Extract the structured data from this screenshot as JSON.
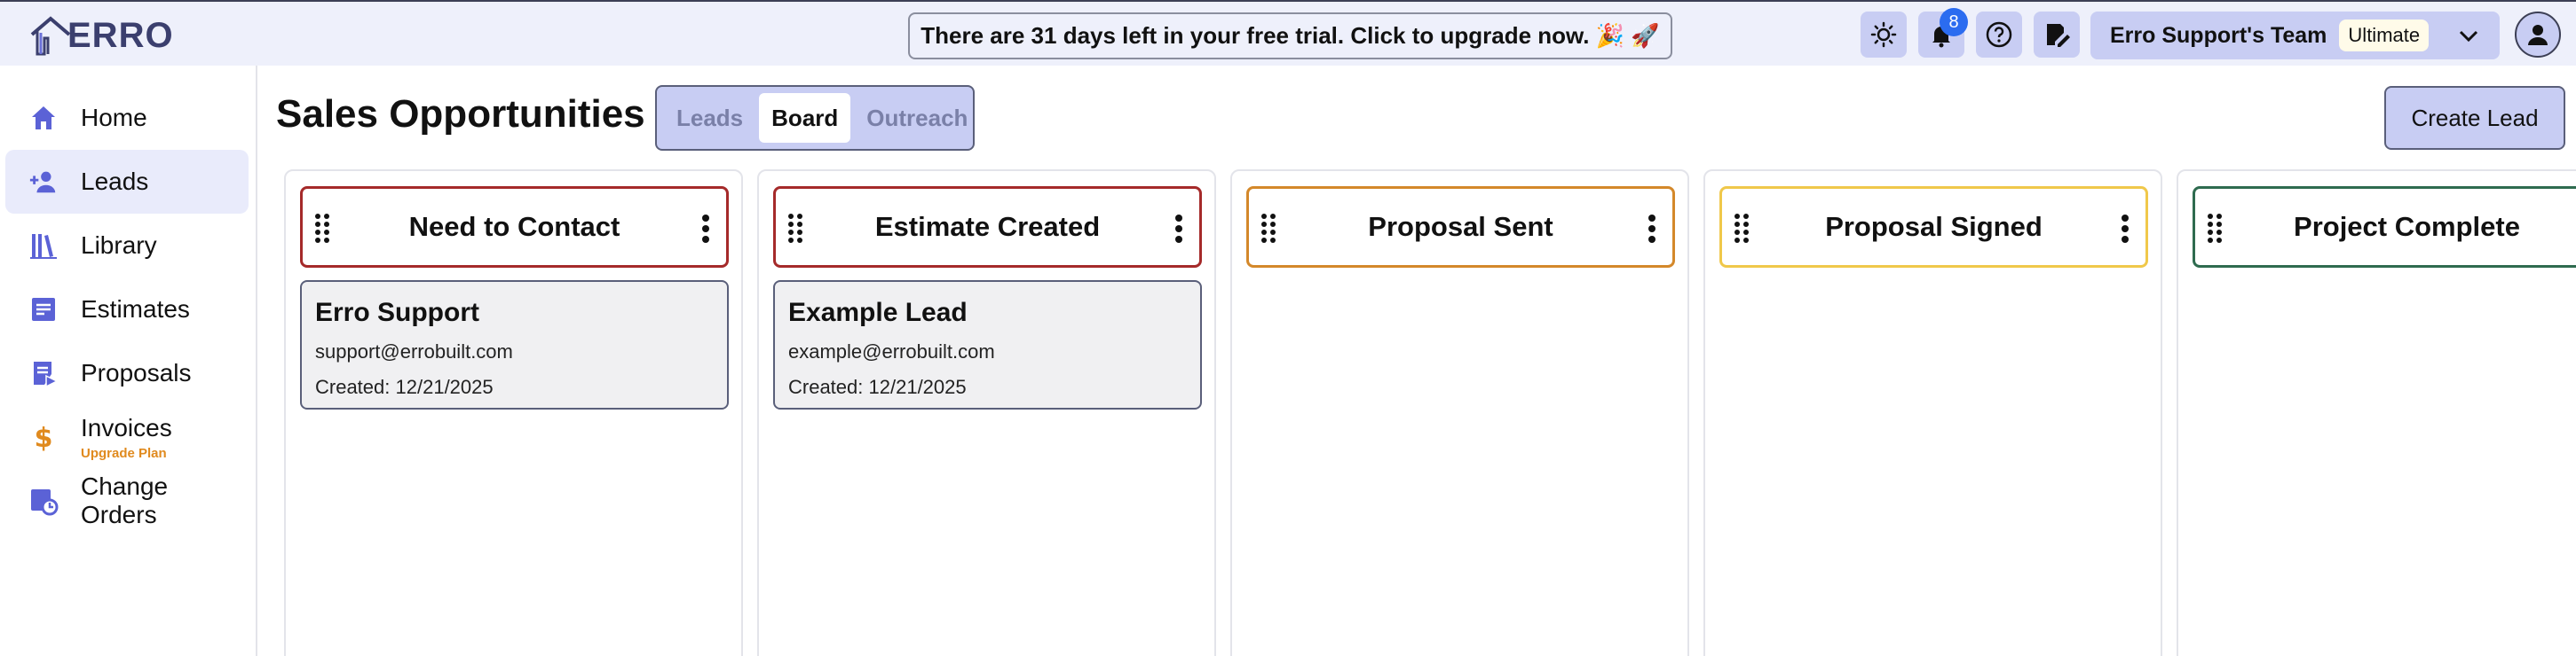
{
  "brand": {
    "name": "ERRO"
  },
  "trial_banner": "There are 31 days left in your free trial. Click to upgrade now. 🎉 🚀",
  "header": {
    "notifications_count": "8",
    "team_name": "Erro Support's Team",
    "plan": "Ultimate"
  },
  "sidebar": {
    "items": [
      {
        "label": "Home",
        "icon": "home-icon"
      },
      {
        "label": "Leads",
        "icon": "add-person-icon"
      },
      {
        "label": "Library",
        "icon": "library-icon"
      },
      {
        "label": "Estimates",
        "icon": "estimate-icon"
      },
      {
        "label": "Proposals",
        "icon": "proposal-icon"
      },
      {
        "label": "Invoices",
        "icon": "dollar-icon",
        "sub": "Upgrade Plan"
      },
      {
        "label": "Change Orders",
        "icon": "change-order-icon"
      }
    ],
    "active": "Leads"
  },
  "main": {
    "title": "Sales Opportunities",
    "tabs": [
      "Leads",
      "Board",
      "Outreach"
    ],
    "active_tab": "Board",
    "create_button": "Create Lead"
  },
  "board": {
    "columns": [
      {
        "title": "Need to Contact",
        "color": "#a52a2a",
        "card": {
          "name": "Erro Support",
          "email": "support@errobuilt.com",
          "created_label": "Created:",
          "created": "12/21/2025"
        }
      },
      {
        "title": "Estimate Created",
        "color": "#a52a2a",
        "card": {
          "name": "Example Lead",
          "email": "example@errobuilt.com",
          "created_label": "Created:",
          "created": "12/21/2025"
        }
      },
      {
        "title": "Proposal Sent",
        "color": "#d4882a"
      },
      {
        "title": "Proposal Signed",
        "color": "#f0c84a"
      },
      {
        "title": "Project Complete",
        "color": "#2e6b4f"
      }
    ]
  },
  "colors": {
    "accent": "#c8cdf3",
    "nav_active": "#e9ebfb",
    "badge": "#2b6cf0",
    "upgrade": "#e08a1e"
  }
}
